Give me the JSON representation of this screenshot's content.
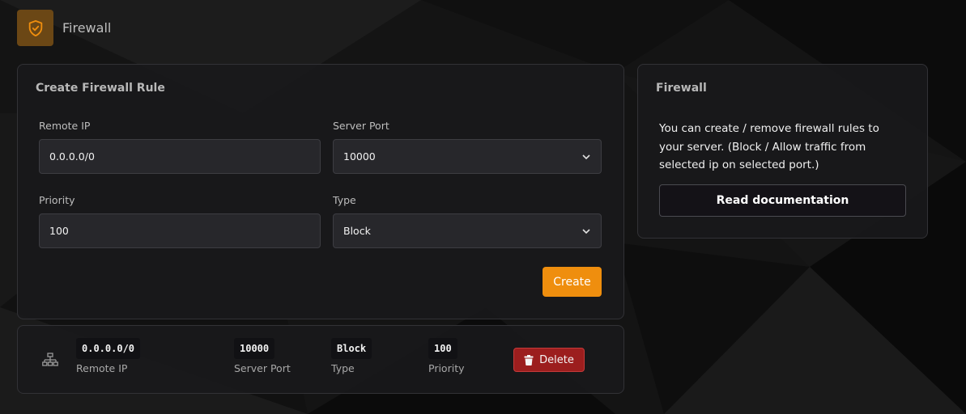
{
  "header": {
    "title": "Firewall",
    "icon": "shield-check-icon",
    "icon_color": "#ef8e0e"
  },
  "create_form": {
    "title": "Create Firewall Rule",
    "remote_ip": {
      "label": "Remote IP",
      "value": "0.0.0.0/0"
    },
    "server_port": {
      "label": "Server Port",
      "selected": "10000"
    },
    "priority": {
      "label": "Priority",
      "value": "100"
    },
    "type": {
      "label": "Type",
      "selected": "Block"
    },
    "create_button": "Create"
  },
  "info": {
    "title": "Firewall",
    "description": "You can create / remove firewall rules to your server. (Block / Allow traffic from selected ip on selected port.)",
    "docs_button": "Read documentation"
  },
  "rules": [
    {
      "icon": "network-icon",
      "remote_ip": "0.0.0.0/0",
      "remote_ip_label": "Remote IP",
      "server_port": "10000",
      "server_port_label": "Server Port",
      "type": "Block",
      "type_label": "Type",
      "priority": "100",
      "priority_label": "Priority",
      "delete_button": "Delete"
    }
  ],
  "colors": {
    "accent": "#ef8e0e",
    "danger": "#9c1e1e",
    "panel": "#19191b"
  }
}
